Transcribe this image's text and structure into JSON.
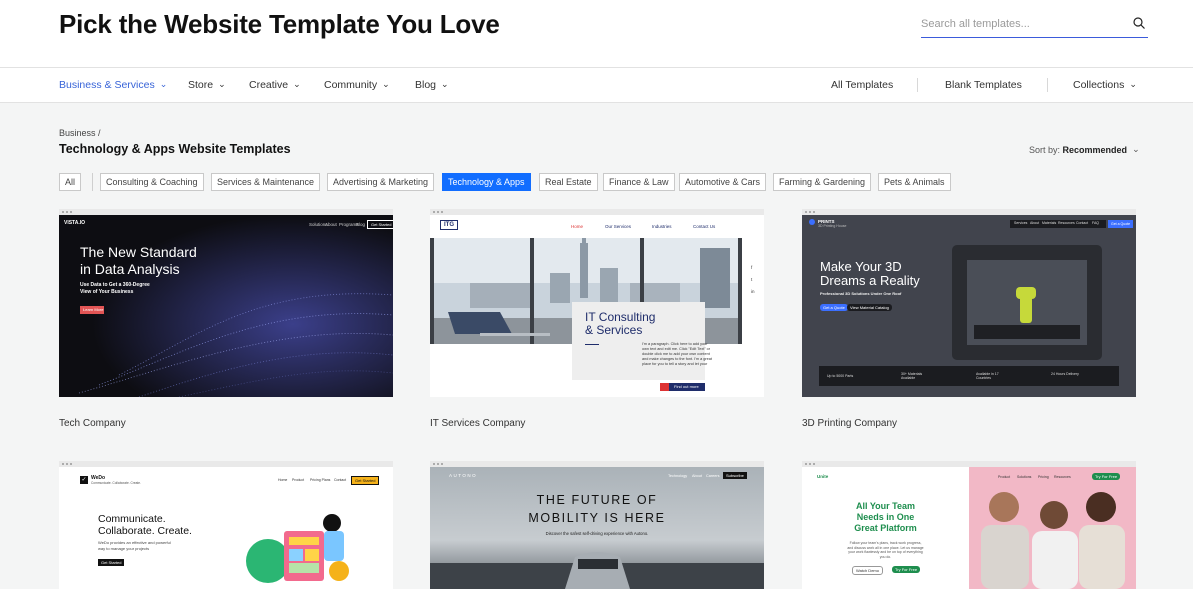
{
  "header": {
    "title": "Pick the Website Template You Love",
    "search_placeholder": "Search all templates..."
  },
  "nav": {
    "categories": [
      "Business & Services",
      "Store",
      "Creative",
      "Community",
      "Blog"
    ],
    "right_links": [
      "All Templates",
      "Blank Templates",
      "Collections"
    ]
  },
  "breadcrumb": "Business /",
  "section_title": "Technology & Apps Website Templates",
  "sort": {
    "label": "Sort by:",
    "value": "Recommended"
  },
  "filters": [
    "All",
    "Consulting & Coaching",
    "Services & Maintenance",
    "Advertising & Marketing",
    "Technology & Apps",
    "Real Estate",
    "Finance & Law",
    "Automotive & Cars",
    "Farming & Gardening",
    "Pets & Animals"
  ],
  "active_filter": "Technology & Apps",
  "cards": [
    {
      "name": "Tech Company",
      "logo": "VISTA.IO",
      "nav": [
        "Solutions",
        "About",
        "Programs",
        "Blog",
        "Get Started"
      ],
      "headline_1": "The New Standard",
      "headline_2": "in Data Analysis",
      "sub_1": "Use Data to Get a 360-Degree",
      "sub_2": "View of Your Business",
      "cta": "Learn More"
    },
    {
      "name": "IT Services Company",
      "logo": "ITG",
      "nav": [
        "Home",
        "Our Services",
        "Industries",
        "Contact Us"
      ],
      "headline_1": "IT Consulting",
      "headline_2": "& Services",
      "body_1": "I'm a paragraph. Click here to add your",
      "body_2": "own text and edit me. Click \"Edit Text\" or",
      "body_3": "double click me to add your own content",
      "body_4": "and make changes to the font. I'm a great",
      "body_5": "place for you to tell a story and let your",
      "cta": "Find out more"
    },
    {
      "name": "3D Printing Company",
      "logo": "PRINTS",
      "logo_sub": "3D Printing House",
      "nav": [
        "Services",
        "About",
        "Materials",
        "Resources",
        "Contact",
        "FAQ",
        "Get a Quote"
      ],
      "headline_1": "Make Your 3D",
      "headline_2": "Dreams a Reality",
      "sub": "Professional 3D Solutions Under One Roof",
      "cta_1": "Get a Quote",
      "cta_2": "View Material Catalog",
      "stats": [
        "Up to 5000 Parts",
        "30+ Materials Available",
        "Available in 17 Countries",
        "24 Hours Delivery"
      ]
    },
    {
      "name": "WeDo",
      "logo": "WeDo",
      "logo_sub": "Communicate. Collaborate. Create.",
      "nav": [
        "Home",
        "Product",
        "Pricing Plans",
        "Contact",
        "Get Started"
      ],
      "headline_1": "Communicate.",
      "headline_2": "Collaborate. Create.",
      "sub_1": "WeDo provides an effective and powerful",
      "sub_2": "way to manage your projects",
      "cta": "Get Started"
    },
    {
      "name": "AUTONO",
      "logo": "AUTONO",
      "nav": [
        "Technology",
        "About",
        "Careers",
        "Subscribe"
      ],
      "headline_1": "THE FUTURE OF",
      "headline_2": "MOBILITY IS HERE",
      "sub": "Discover the safest self-driving experience with Autono."
    },
    {
      "name": "Unite",
      "logo": "Unite",
      "nav": [
        "Product",
        "Solutions",
        "Pricing",
        "Resources",
        "Try For Free"
      ],
      "headline_1": "All Your Team",
      "headline_2": "Needs in One",
      "headline_3": "Great Platform",
      "sub_1": "Follow your team's plans, track work progress,",
      "sub_2": "and discuss work all in one place. Let us manage",
      "sub_3": "your work flawlessly and be on top of everything",
      "sub_4": "you do.",
      "cta_1": "Watch Demo",
      "cta_2": "Try For Free"
    }
  ],
  "colors": {
    "accent": "#116dff",
    "nav_active": "#3864d8",
    "background": "#f4f5f5"
  }
}
